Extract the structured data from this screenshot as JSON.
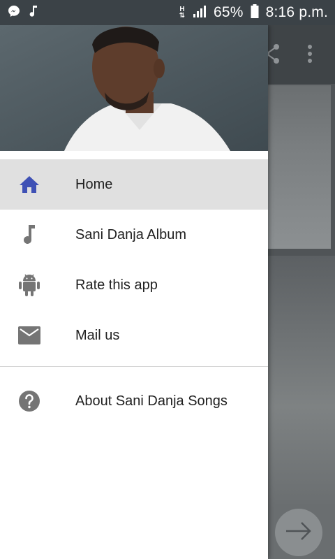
{
  "status_bar": {
    "network_letter": "H",
    "battery_percent": "65%",
    "time": "8:16 p.m.",
    "icons": [
      "messenger-icon",
      "music-note-icon",
      "network-h-icon",
      "signal-bars-icon",
      "battery-icon"
    ]
  },
  "drawer": {
    "header_image": "artist-photo",
    "items": [
      {
        "label": "Home",
        "icon": "home-icon",
        "active": true
      },
      {
        "label": "Sani Danja Album",
        "icon": "music-note-icon",
        "active": false
      },
      {
        "label": "Rate this app",
        "icon": "android-icon",
        "active": false
      },
      {
        "label": "Mail us",
        "icon": "mail-icon",
        "active": false
      }
    ],
    "secondary_items": [
      {
        "label": "About Sani Danja Songs",
        "icon": "help-icon"
      }
    ]
  },
  "background_app": {
    "icons": [
      "share-icon",
      "more-vert-icon",
      "arrow-forward-icon"
    ]
  },
  "colors": {
    "status_bar": "#3b4247",
    "home_icon": "#3f51b5",
    "icon_gray": "#757575",
    "active_row": "#e0e0e0"
  }
}
